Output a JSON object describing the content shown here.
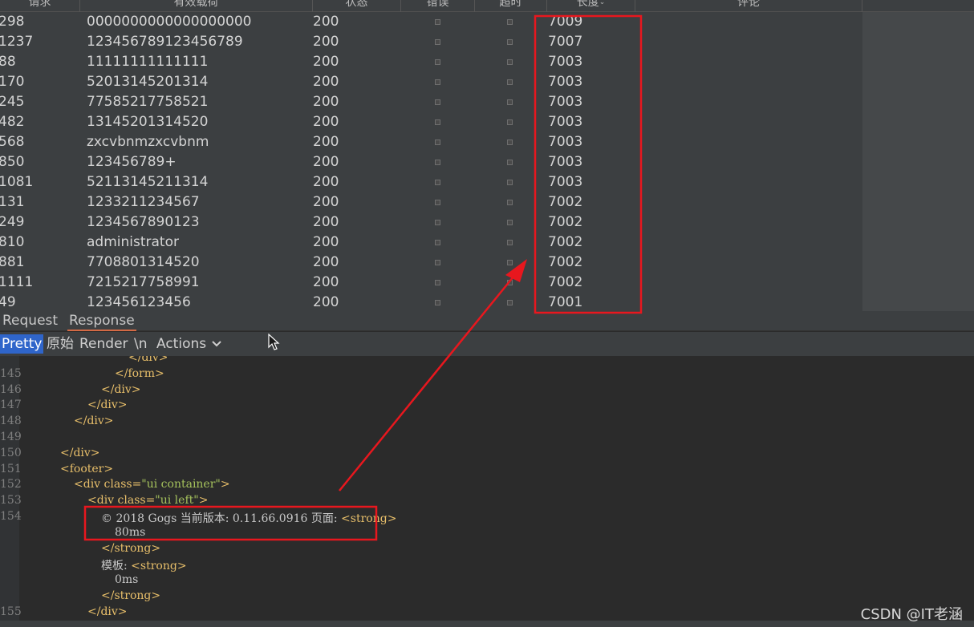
{
  "table": {
    "headers": {
      "request": "请求",
      "payload": "有效载荷",
      "status": "状态",
      "error": "错误",
      "timeout": "超时",
      "length": "长度",
      "comment": "评论"
    },
    "rows": [
      {
        "request": "298",
        "payload": "0000000000000000000",
        "status": "200",
        "length": "7009"
      },
      {
        "request": "1237",
        "payload": "123456789123456789",
        "status": "200",
        "length": "7007"
      },
      {
        "request": "88",
        "payload": "11111111111111",
        "status": "200",
        "length": "7003"
      },
      {
        "request": "170",
        "payload": "52013145201314",
        "status": "200",
        "length": "7003"
      },
      {
        "request": "245",
        "payload": "77585217758521",
        "status": "200",
        "length": "7003"
      },
      {
        "request": "482",
        "payload": "13145201314520",
        "status": "200",
        "length": "7003"
      },
      {
        "request": "568",
        "payload": "zxcvbnmzxcvbnm",
        "status": "200",
        "length": "7003"
      },
      {
        "request": "850",
        "payload": "123456789+",
        "status": "200",
        "length": "7003"
      },
      {
        "request": "1081",
        "payload": "52113145211314",
        "status": "200",
        "length": "7003"
      },
      {
        "request": "131",
        "payload": "1233211234567",
        "status": "200",
        "length": "7002"
      },
      {
        "request": "249",
        "payload": "1234567890123",
        "status": "200",
        "length": "7002"
      },
      {
        "request": "810",
        "payload": "administrator",
        "status": "200",
        "length": "7002"
      },
      {
        "request": "881",
        "payload": "7708801314520",
        "status": "200",
        "length": "7002"
      },
      {
        "request": "1111",
        "payload": "7215217758991",
        "status": "200",
        "length": "7002"
      },
      {
        "request": "49",
        "payload": "123456123456",
        "status": "200",
        "length": "7001"
      }
    ]
  },
  "tabs": {
    "request": "Request",
    "response": "Response"
  },
  "toolbar": {
    "pretty": "Pretty",
    "raw": "原始",
    "render": "Render",
    "newline": "\\n",
    "actions": "Actions"
  },
  "code": {
    "lines": [
      {
        "num": "",
        "indent": 5,
        "tag": "</div>",
        "kind": "tag"
      },
      {
        "num": "145",
        "indent": 4,
        "tag": "</form>",
        "kind": "tag"
      },
      {
        "num": "146",
        "indent": 3,
        "tag": "</div>",
        "kind": "tag"
      },
      {
        "num": "147",
        "indent": 2,
        "tag": "</div>",
        "kind": "tag"
      },
      {
        "num": "148",
        "indent": 1,
        "tag": "</div>",
        "kind": "tag"
      },
      {
        "num": "149",
        "indent": 0,
        "tag": "",
        "kind": "tag"
      },
      {
        "num": "150",
        "indent": 0,
        "tag": "</div>",
        "kind": "tag"
      },
      {
        "num": "151",
        "indent": 0,
        "tag": "<footer>",
        "kind": "tag"
      },
      {
        "num": "152",
        "indent": 1,
        "tag": "<div class=",
        "str": "\"ui container\"",
        "end": ">",
        "kind": "attr"
      },
      {
        "num": "153",
        "indent": 2,
        "tag": "<div class=",
        "str": "\"ui left\"",
        "end": ">",
        "kind": "attr"
      },
      {
        "num": "154",
        "indent": 3,
        "text": "© 2018 Gogs 当前版本: 0.11.66.0916 页面: ",
        "tag": "<strong>",
        "kind": "text-tag"
      },
      {
        "num": "",
        "indent": 4,
        "text": "80ms",
        "kind": "text"
      },
      {
        "num": "",
        "indent": 3,
        "tag": "</strong>",
        "kind": "tag"
      },
      {
        "num": "",
        "indent": 3,
        "text": "模板: ",
        "tag": "<strong>",
        "kind": "text-tag"
      },
      {
        "num": "",
        "indent": 4,
        "text": "0ms",
        "kind": "text"
      },
      {
        "num": "",
        "indent": 3,
        "tag": "</strong>",
        "kind": "tag"
      },
      {
        "num": "155",
        "indent": 2,
        "tag": "</div>",
        "kind": "tag"
      }
    ]
  },
  "annotation": {
    "color": "#e8171e"
  },
  "watermark": "CSDN @IT老涵"
}
